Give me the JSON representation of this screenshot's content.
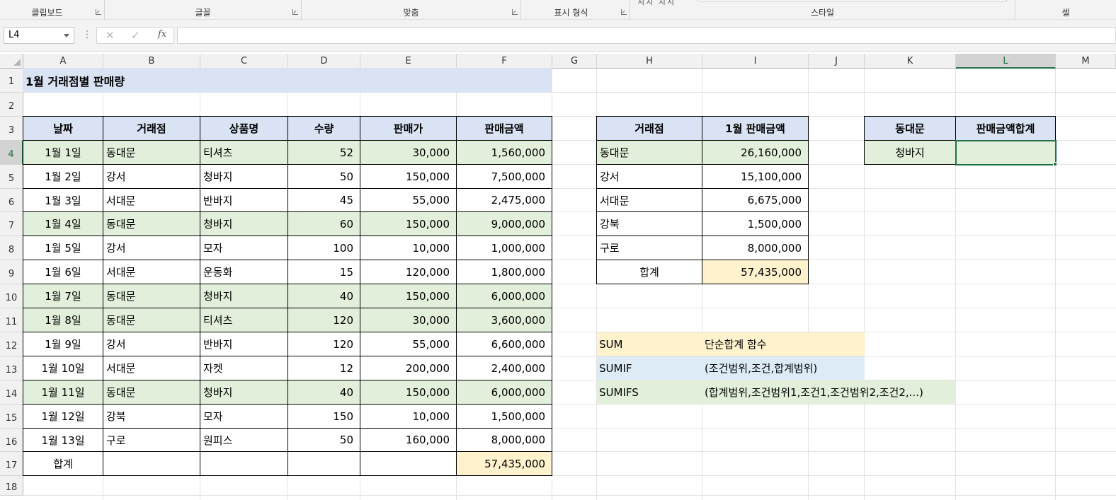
{
  "ribbon": {
    "groups": [
      "클립보드",
      "글꼴",
      "맞춤",
      "표시 형식",
      "스타일",
      "셀"
    ],
    "style_fragment": "치치 치치"
  },
  "formula_bar": {
    "name_box": "L4",
    "cancel_glyph": "✕",
    "enter_glyph": "✓",
    "fx": "fx",
    "formula": ""
  },
  "columns": [
    "A",
    "B",
    "C",
    "D",
    "E",
    "F",
    "G",
    "H",
    "I",
    "J",
    "K",
    "L",
    "M"
  ],
  "rows": [
    "1",
    "2",
    "3",
    "4",
    "5",
    "6",
    "7",
    "8",
    "9",
    "10",
    "11",
    "12",
    "13",
    "14",
    "15",
    "16",
    "17",
    "18"
  ],
  "active_cell": {
    "col": "L",
    "row": "4"
  },
  "title": "1월 거래점별 판매량",
  "main_table": {
    "headers": [
      "날짜",
      "거래점",
      "상품명",
      "수량",
      "판매가",
      "판매금액"
    ],
    "rows": [
      [
        "1월 1일",
        "동대문",
        "티셔츠",
        "52",
        "30,000",
        "1,560,000"
      ],
      [
        "1월 2일",
        "강서",
        "청바지",
        "50",
        "150,000",
        "7,500,000"
      ],
      [
        "1월 3일",
        "서대문",
        "반바지",
        "45",
        "55,000",
        "2,475,000"
      ],
      [
        "1월 4일",
        "동대문",
        "청바지",
        "60",
        "150,000",
        "9,000,000"
      ],
      [
        "1월 5일",
        "강서",
        "모자",
        "100",
        "10,000",
        "1,000,000"
      ],
      [
        "1월 6일",
        "서대문",
        "운동화",
        "15",
        "120,000",
        "1,800,000"
      ],
      [
        "1월 7일",
        "동대문",
        "청바지",
        "40",
        "150,000",
        "6,000,000"
      ],
      [
        "1월 8일",
        "동대문",
        "티셔츠",
        "120",
        "30,000",
        "3,600,000"
      ],
      [
        "1월 9일",
        "강서",
        "반바지",
        "120",
        "55,000",
        "6,600,000"
      ],
      [
        "1월 10일",
        "서대문",
        "자켓",
        "12",
        "200,000",
        "2,400,000"
      ],
      [
        "1월 11일",
        "동대문",
        "청바지",
        "40",
        "150,000",
        "6,000,000"
      ],
      [
        "1월 12일",
        "강북",
        "모자",
        "150",
        "10,000",
        "1,500,000"
      ],
      [
        "1월 13일",
        "구로",
        "원피스",
        "50",
        "160,000",
        "8,000,000"
      ]
    ],
    "highlight_rows": [
      0,
      3,
      6,
      7,
      10
    ],
    "total_label": "합계",
    "total_value": "57,435,000"
  },
  "summary_table": {
    "headers": [
      "거래점",
      "1월 판매금액"
    ],
    "rows": [
      [
        "동대문",
        "26,160,000"
      ],
      [
        "강서",
        "15,100,000"
      ],
      [
        "서대문",
        "6,675,000"
      ],
      [
        "강북",
        "1,500,000"
      ],
      [
        "구로",
        "8,000,000"
      ]
    ],
    "total_label": "합계",
    "total_value": "57,435,000"
  },
  "functions": [
    {
      "name": "SUM",
      "desc": "단순합계 함수",
      "color": "#fff2cc"
    },
    {
      "name": "SUMIF",
      "desc": "(조건범위,조건,합계범위)",
      "color": "#ddebf7"
    },
    {
      "name": "SUMIFS",
      "desc": "(합계범위,조건범위1,조건1,조건범위2,조건2,...)",
      "color": "#e2efda"
    }
  ],
  "criteria_table": {
    "headers": [
      "동대문",
      "판매금액합계"
    ],
    "row": [
      "청바지",
      ""
    ]
  },
  "colors": {
    "header_blue": "#dae3f3",
    "highlight_green": "#e2efda",
    "total_yellow": "#fff2cc",
    "selection_green": "#217346"
  }
}
